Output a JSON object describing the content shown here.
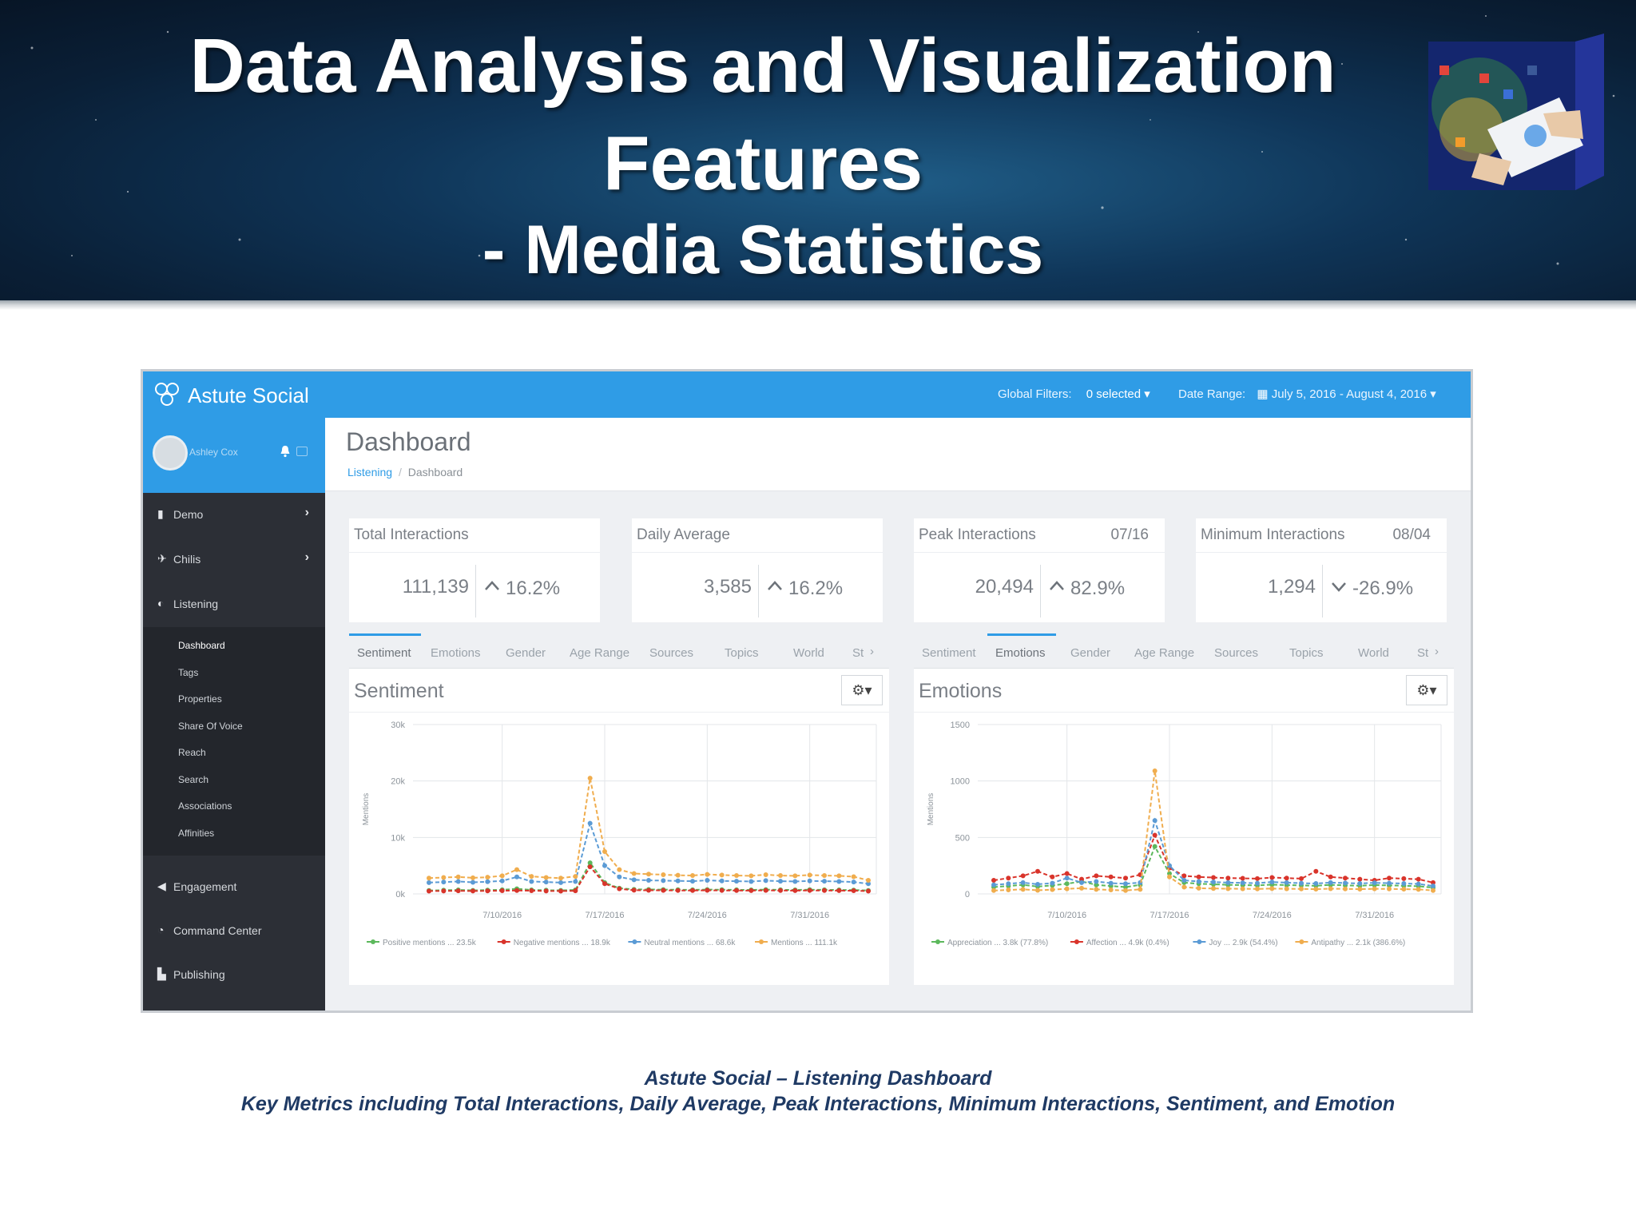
{
  "slide": {
    "title_line1": "Data Analysis and Visualization",
    "title_line2": "Features",
    "title_line3": "- Media Statistics",
    "caption_line1": "Astute Social – Listening Dashboard",
    "caption_line2": "Key Metrics including Total Interactions, Daily Average, Peak Interactions, Minimum Interactions, Sentiment, and Emotion"
  },
  "colors": {
    "accent": "#2f9ce6",
    "sidebar": "#2c2f36",
    "caption": "#1f3a64",
    "green": "#5cb85c",
    "red": "#d9342b",
    "blue": "#5b9bd5",
    "orange": "#f0ad4e"
  },
  "app": {
    "brand": "Astute Social",
    "global_filters_label": "Global Filters:",
    "global_filters_value": "0 selected ▾",
    "date_range_label": "Date Range:",
    "date_range_value": "July 5, 2016 - August 4, 2016 ▾",
    "user_name": "Ashley Cox"
  },
  "sidebar": {
    "main_items": [
      {
        "label": "Demo",
        "icon": "building-icon"
      },
      {
        "label": "Chilis",
        "icon": "plane-icon"
      },
      {
        "label": "Listening",
        "icon": "ear-icon"
      }
    ],
    "sub_items": [
      "Dashboard",
      "Tags",
      "Properties",
      "Share Of Voice",
      "Reach",
      "Search",
      "Associations",
      "Affinities"
    ],
    "bottom_items": [
      {
        "label": "Engagement",
        "icon": "megaphone-icon"
      },
      {
        "label": "Command Center",
        "icon": "dashboard-icon"
      },
      {
        "label": "Publishing",
        "icon": "edit-icon"
      }
    ]
  },
  "page": {
    "title": "Dashboard",
    "breadcrumb_link": "Listening",
    "breadcrumb_sep": "/",
    "breadcrumb_current": "Dashboard"
  },
  "cards": [
    {
      "title": "Total Interactions",
      "date": "",
      "value": "111,139",
      "change": "16.2%",
      "direction": "up"
    },
    {
      "title": "Daily Average",
      "date": "",
      "value": "3,585",
      "change": "16.2%",
      "direction": "up"
    },
    {
      "title": "Peak Interactions",
      "date": "07/16",
      "value": "20,494",
      "change": "82.9%",
      "direction": "up"
    },
    {
      "title": "Minimum Interactions",
      "date": "08/04",
      "value": "1,294",
      "change": "-26.9%",
      "direction": "down"
    }
  ],
  "tabs": [
    "Sentiment",
    "Emotions",
    "Gender",
    "Age Range",
    "Sources",
    "Topics",
    "World",
    "St"
  ],
  "panels": [
    {
      "title": "Sentiment",
      "active_tab": 0
    },
    {
      "title": "Emotions",
      "active_tab": 1
    }
  ],
  "chart_data": [
    {
      "type": "line",
      "title": "Sentiment",
      "xlabel": "",
      "ylabel": "Mentions",
      "ylim": [
        0,
        30000
      ],
      "yticks": [
        "30k",
        "20k",
        "10k",
        "0k"
      ],
      "ytick_values": [
        30000,
        20000,
        10000,
        0
      ],
      "xticks": [
        "7/10/2016",
        "7/17/2016",
        "7/24/2016",
        "7/31/2016"
      ],
      "xtick_index": [
        5,
        12,
        19,
        26
      ],
      "x": [
        "7/5",
        "7/6",
        "7/7",
        "7/8",
        "7/9",
        "7/10",
        "7/11",
        "7/12",
        "7/13",
        "7/14",
        "7/15",
        "7/16",
        "7/17",
        "7/18",
        "7/19",
        "7/20",
        "7/21",
        "7/22",
        "7/23",
        "7/24",
        "7/25",
        "7/26",
        "7/27",
        "7/28",
        "7/29",
        "7/30",
        "7/31",
        "8/1",
        "8/2",
        "8/3",
        "8/4"
      ],
      "legend": "bottom",
      "series": [
        {
          "name": "Positive mentions",
          "legend_label": "Positive mentions ... 23.5k",
          "color": "#5cb85c",
          "values": [
            600,
            650,
            700,
            620,
            680,
            720,
            900,
            700,
            650,
            620,
            700,
            5500,
            2000,
            1000,
            800,
            780,
            760,
            740,
            720,
            760,
            740,
            720,
            700,
            760,
            720,
            700,
            740,
            720,
            700,
            680,
            600
          ]
        },
        {
          "name": "Negative mentions",
          "legend_label": "Negative mentions ... 18.9k",
          "color": "#d9342b",
          "values": [
            500,
            520,
            540,
            510,
            530,
            560,
            600,
            560,
            520,
            500,
            540,
            4800,
            1800,
            900,
            650,
            640,
            620,
            610,
            600,
            630,
            610,
            600,
            580,
            620,
            600,
            580,
            610,
            600,
            580,
            560,
            500
          ]
        },
        {
          "name": "Neutral mentions",
          "legend_label": "Neutral mentions ... 68.6k",
          "color": "#5b9bd5",
          "values": [
            2000,
            2100,
            2200,
            2050,
            2150,
            2300,
            3000,
            2200,
            2100,
            2000,
            2200,
            12500,
            5000,
            3000,
            2500,
            2400,
            2350,
            2300,
            2250,
            2400,
            2300,
            2250,
            2200,
            2350,
            2250,
            2200,
            2300,
            2250,
            2200,
            2100,
            1800
          ]
        },
        {
          "name": "Mentions",
          "legend_label": "Mentions ... 111.1k",
          "color": "#f0ad4e",
          "values": [
            2800,
            2900,
            3000,
            2850,
            2950,
            3200,
            4300,
            3100,
            2900,
            2800,
            3100,
            20500,
            7500,
            4300,
            3600,
            3500,
            3400,
            3300,
            3250,
            3450,
            3350,
            3250,
            3200,
            3400,
            3250,
            3200,
            3350,
            3250,
            3200,
            3050,
            2400
          ]
        }
      ]
    },
    {
      "type": "line",
      "title": "Emotions",
      "xlabel": "",
      "ylabel": "Mentions",
      "ylim": [
        0,
        1500
      ],
      "yticks": [
        "1500",
        "1000",
        "500",
        "0"
      ],
      "ytick_values": [
        1500,
        1000,
        500,
        0
      ],
      "xticks": [
        "7/10/2016",
        "7/17/2016",
        "7/24/2016",
        "7/31/2016"
      ],
      "xtick_index": [
        5,
        12,
        19,
        26
      ],
      "x": [
        "7/5",
        "7/6",
        "7/7",
        "7/8",
        "7/9",
        "7/10",
        "7/11",
        "7/12",
        "7/13",
        "7/14",
        "7/15",
        "7/16",
        "7/17",
        "7/18",
        "7/19",
        "7/20",
        "7/21",
        "7/22",
        "7/23",
        "7/24",
        "7/25",
        "7/26",
        "7/27",
        "7/28",
        "7/29",
        "7/30",
        "7/31",
        "8/1",
        "8/2",
        "8/3",
        "8/4"
      ],
      "legend": "bottom",
      "series": [
        {
          "name": "Appreciation",
          "legend_label": "Appreciation ... 3.8k (77.8%)",
          "color": "#5cb85c",
          "values": [
            60,
            70,
            80,
            65,
            75,
            90,
            110,
            80,
            70,
            60,
            80,
            420,
            180,
            100,
            90,
            85,
            80,
            78,
            75,
            82,
            78,
            75,
            72,
            80,
            76,
            72,
            78,
            75,
            72,
            68,
            55
          ]
        },
        {
          "name": "Affection",
          "legend_label": "Affection ... 4.9k (0.4%)",
          "color": "#d9342b",
          "values": [
            120,
            140,
            160,
            200,
            150,
            180,
            130,
            160,
            150,
            140,
            170,
            520,
            230,
            160,
            150,
            145,
            140,
            138,
            135,
            145,
            140,
            135,
            200,
            150,
            140,
            130,
            120,
            140,
            135,
            130,
            100
          ]
        },
        {
          "name": "Joy",
          "legend_label": "Joy ... 2.9k (54.4%)",
          "color": "#5b9bd5",
          "values": [
            80,
            90,
            100,
            85,
            95,
            140,
            100,
            110,
            95,
            90,
            100,
            650,
            250,
            120,
            110,
            105,
            100,
            98,
            95,
            105,
            100,
            95,
            92,
            100,
            96,
            92,
            98,
            95,
            92,
            88,
            70
          ]
        },
        {
          "name": "Antipathy",
          "legend_label": "Antipathy ... 2.1k (386.6%)",
          "color": "#f0ad4e",
          "values": [
            30,
            35,
            40,
            32,
            38,
            45,
            50,
            40,
            35,
            30,
            40,
            1090,
            150,
            60,
            50,
            48,
            46,
            45,
            44,
            47,
            45,
            44,
            42,
            46,
            44,
            42,
            45,
            44,
            42,
            40,
            30
          ]
        }
      ]
    }
  ]
}
